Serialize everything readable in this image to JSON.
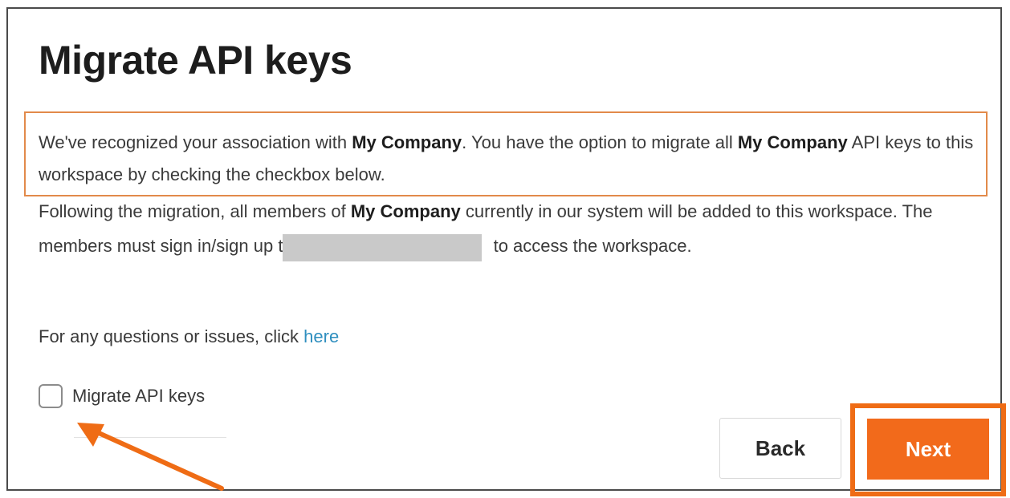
{
  "dialog": {
    "title": "Migrate API keys",
    "intro": {
      "t1": "We've recognized your association with ",
      "company1": "My Company",
      "t2": ". You have the option to migrate all ",
      "company2": "My Company",
      "t3": " API keys to this workspace by checking the checkbox below."
    },
    "details": {
      "t1": "Following the migration, all members of ",
      "company": "My Company",
      "t2": " currently in our system will be added to this workspace. The members must sign in/sign up t",
      "t3": " to access the workspace."
    },
    "help": {
      "text": "For any questions or issues, click ",
      "link": "here"
    },
    "checkbox": {
      "label": "Migrate API keys",
      "checked": false
    },
    "buttons": {
      "back": "Back",
      "next": "Next"
    }
  },
  "colors": {
    "accent": "#f26a1b",
    "highlight_border": "#e28a4a",
    "link": "#2f8fbf",
    "redaction": "#c9c9c9"
  },
  "icons": {
    "annotation_arrow": "arrow-pointing-to-checkbox-icon"
  }
}
